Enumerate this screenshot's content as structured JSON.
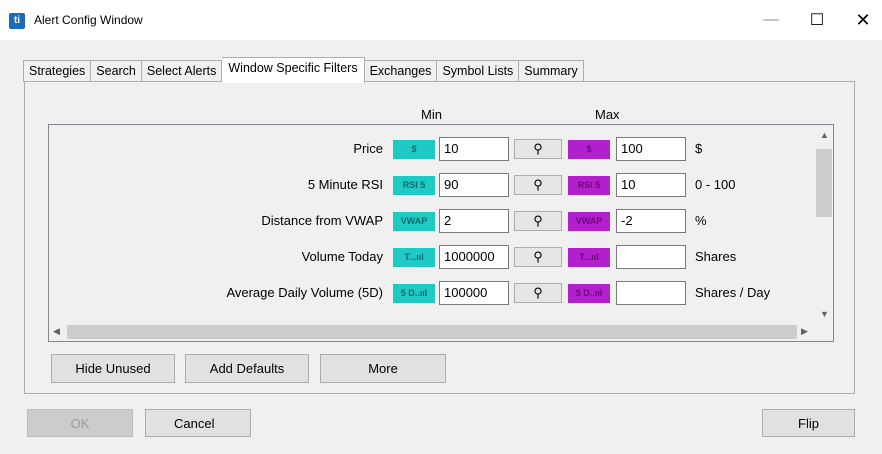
{
  "window": {
    "title": "Alert Config Window",
    "icon_text": "ti"
  },
  "tabs": [
    "Strategies",
    "Search",
    "Select Alerts",
    "Window Specific Filters",
    "Exchanges",
    "Symbol Lists",
    "Summary"
  ],
  "active_tab": "Window Specific Filters",
  "headers": {
    "min": "Min",
    "max": "Max"
  },
  "filters": [
    {
      "label": "Price",
      "icon": "$",
      "min": "10",
      "max": "100",
      "unit": "$"
    },
    {
      "label": "5 Minute RSI",
      "icon": "RSI 5",
      "min": "90",
      "max": "10",
      "unit": "0 - 100"
    },
    {
      "label": "Distance from VWAP",
      "icon": "VWAP",
      "min": "2",
      "max": "-2",
      "unit": "%"
    },
    {
      "label": "Volume Today",
      "icon": "T...ııl",
      "min": "1000000",
      "max": "",
      "unit": "Shares"
    },
    {
      "label": "Average Daily Volume (5D)",
      "icon": "5 D..ııl",
      "min": "100000",
      "max": "",
      "unit": "Shares / Day"
    }
  ],
  "buttons": {
    "hide_unused": "Hide Unused",
    "add_defaults": "Add Defaults",
    "more": "More",
    "ok": "OK",
    "cancel": "Cancel",
    "flip": "Flip"
  },
  "colors": {
    "min_icon": "#1fc9c4",
    "max_icon": "#b21fcc"
  }
}
